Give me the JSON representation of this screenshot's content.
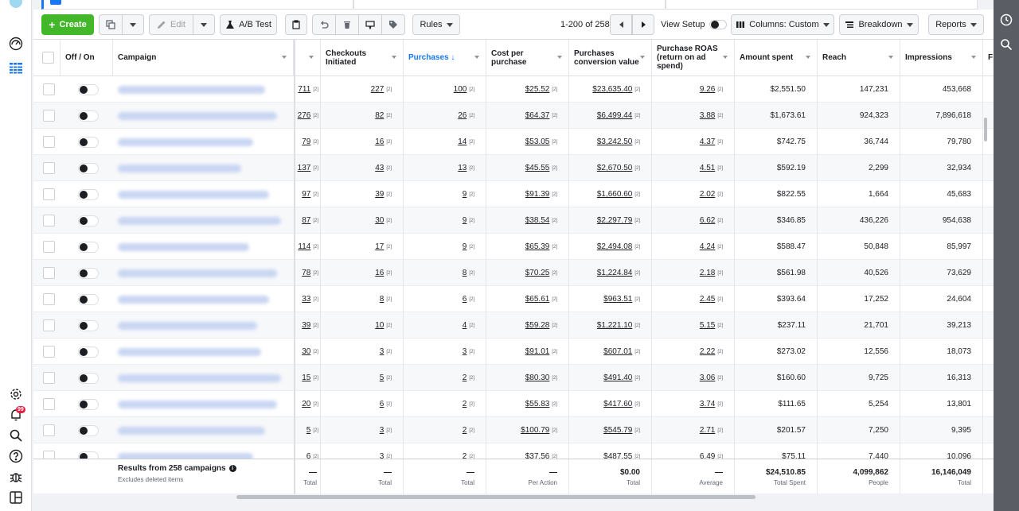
{
  "toolbar": {
    "create_label": "Create",
    "edit_label": "Edit",
    "ab_test_label": "A/B Test",
    "rules_label": "Rules",
    "pagination": "1-200 of 258",
    "view_setup_label": "View Setup",
    "columns_label": "Columns: Custom",
    "breakdown_label": "Breakdown",
    "reports_label": "Reports"
  },
  "headers": {
    "off_on": "Off / On",
    "campaign": "Campaign",
    "checkouts": "Checkouts Initiated",
    "purchases": "Purchases ↓",
    "cost_per_purchase": "Cost per purchase",
    "conversion_value": "Purchases conversion value",
    "roas": "Purchase ROAS (return on ad spend)",
    "amount_spent": "Amount spent",
    "reach": "Reach",
    "impressions": "Impressions",
    "next": "F"
  },
  "note": "[2]",
  "rows": [
    {
      "prev": "711",
      "checkouts": "227",
      "purchases": "100",
      "cpp": "$25.52",
      "value": "$23,635.40",
      "roas": "9.26",
      "spent": "$2,551.50",
      "reach": "147,231",
      "impressions": "453,668"
    },
    {
      "prev": "276",
      "checkouts": "82",
      "purchases": "26",
      "cpp": "$64.37",
      "value": "$6,499.44",
      "roas": "3.88",
      "spent": "$1,673.61",
      "reach": "924,323",
      "impressions": "7,896,618"
    },
    {
      "prev": "79",
      "checkouts": "16",
      "purchases": "14",
      "cpp": "$53.05",
      "value": "$3,242.50",
      "roas": "4.37",
      "spent": "$742.75",
      "reach": "36,744",
      "impressions": "79,780"
    },
    {
      "prev": "137",
      "checkouts": "43",
      "purchases": "13",
      "cpp": "$45.55",
      "value": "$2,670.50",
      "roas": "4.51",
      "spent": "$592.19",
      "reach": "2,299",
      "impressions": "32,934"
    },
    {
      "prev": "97",
      "checkouts": "39",
      "purchases": "9",
      "cpp": "$91.39",
      "value": "$1,660.60",
      "roas": "2.02",
      "spent": "$822.55",
      "reach": "1,664",
      "impressions": "45,683"
    },
    {
      "prev": "87",
      "checkouts": "30",
      "purchases": "9",
      "cpp": "$38.54",
      "value": "$2,297.79",
      "roas": "6.62",
      "spent": "$346.85",
      "reach": "436,226",
      "impressions": "954,638"
    },
    {
      "prev": "114",
      "checkouts": "17",
      "purchases": "9",
      "cpp": "$65.39",
      "value": "$2,494.08",
      "roas": "4.24",
      "spent": "$588.47",
      "reach": "50,848",
      "impressions": "85,997"
    },
    {
      "prev": "78",
      "checkouts": "16",
      "purchases": "8",
      "cpp": "$70.25",
      "value": "$1,224.84",
      "roas": "2.18",
      "spent": "$561.98",
      "reach": "40,526",
      "impressions": "73,629"
    },
    {
      "prev": "33",
      "checkouts": "8",
      "purchases": "6",
      "cpp": "$65.61",
      "value": "$963.51",
      "roas": "2.45",
      "spent": "$393.64",
      "reach": "17,252",
      "impressions": "24,604"
    },
    {
      "prev": "39",
      "checkouts": "10",
      "purchases": "4",
      "cpp": "$59.28",
      "value": "$1,221.10",
      "roas": "5.15",
      "spent": "$237.11",
      "reach": "21,701",
      "impressions": "39,213"
    },
    {
      "prev": "30",
      "checkouts": "3",
      "purchases": "3",
      "cpp": "$91.01",
      "value": "$607.01",
      "roas": "2.22",
      "spent": "$273.02",
      "reach": "12,556",
      "impressions": "18,073"
    },
    {
      "prev": "15",
      "checkouts": "5",
      "purchases": "2",
      "cpp": "$80.30",
      "value": "$491.40",
      "roas": "3.06",
      "spent": "$160.60",
      "reach": "9,725",
      "impressions": "16,313"
    },
    {
      "prev": "20",
      "checkouts": "6",
      "purchases": "2",
      "cpp": "$55.83",
      "value": "$417.60",
      "roas": "3.74",
      "spent": "$111.65",
      "reach": "5,254",
      "impressions": "13,801"
    },
    {
      "prev": "5",
      "checkouts": "3",
      "purchases": "2",
      "cpp": "$100.79",
      "value": "$545.79",
      "roas": "2.71",
      "spent": "$201.57",
      "reach": "7,250",
      "impressions": "9,395"
    },
    {
      "prev": "6",
      "checkouts": "3",
      "purchases": "2",
      "cpp": "$37.56",
      "value": "$487.55",
      "roas": "6.49",
      "spent": "$75.11",
      "reach": "7,440",
      "impressions": "10,096"
    }
  ],
  "footer": {
    "title": "Results from 258 campaigns",
    "subtitle": "Excludes deleted items",
    "prev": {
      "v": "—",
      "l": "Total"
    },
    "checkouts": {
      "v": "—",
      "l": "Total"
    },
    "purchases": {
      "v": "—",
      "l": "Total"
    },
    "cpp": {
      "v": "—",
      "l": "Per Action"
    },
    "value": {
      "v": "$0.00",
      "l": "Total"
    },
    "roas": {
      "v": "—",
      "l": "Average"
    },
    "spent": {
      "v": "$24,510.85",
      "l": "Total Spent"
    },
    "reach": {
      "v": "4,099,862",
      "l": "People"
    },
    "impressions": {
      "v": "16,146,049",
      "l": "Total"
    }
  },
  "notifications_count": "99",
  "colors": {
    "accent": "#1877f2",
    "create": "#42b72a",
    "badge": "#e41e3f"
  }
}
